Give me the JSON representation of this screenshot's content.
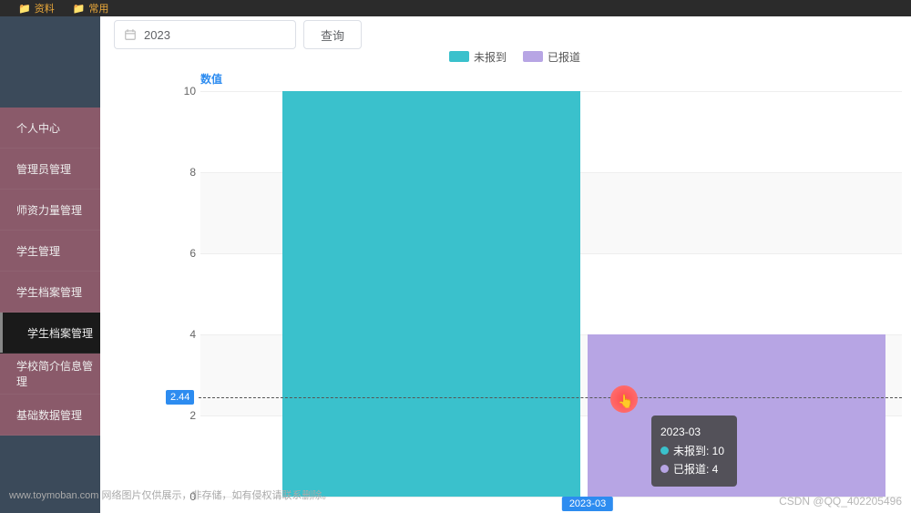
{
  "topbar": {
    "item1": "资料",
    "item2": "常用"
  },
  "toolbar": {
    "year": "2023",
    "query": "查询"
  },
  "sidebar": {
    "items": [
      {
        "label": "个人中心"
      },
      {
        "label": "管理员管理"
      },
      {
        "label": "师资力量管理"
      },
      {
        "label": "学生管理"
      },
      {
        "label": "学生档案管理"
      },
      {
        "label": "学生档案管理",
        "active": true
      },
      {
        "label": "学校简介信息管理"
      },
      {
        "label": "基础数据管理"
      }
    ]
  },
  "chart_data": {
    "type": "bar",
    "axis_title": "数值",
    "categories": [
      "2023-03"
    ],
    "series": [
      {
        "name": "未报到",
        "color": "#3ac1cc",
        "values": [
          10
        ]
      },
      {
        "name": "已报道",
        "color": "#b7a5e4",
        "values": [
          4
        ]
      }
    ],
    "ylim": [
      0,
      10
    ],
    "yticks": [
      0,
      2,
      4,
      6,
      8,
      10
    ],
    "marker_value": 2.44,
    "tooltip": {
      "title": "2023-03",
      "rows": [
        {
          "color": "#3ac1cc",
          "label": "未报到",
          "value": 10
        },
        {
          "color": "#b7a5e4",
          "label": "已报道",
          "value": 4
        }
      ]
    }
  },
  "footer": {
    "watermark": "www.toymoban.com 网络图片仅供展示，非存储，如有侵权请联系删除。",
    "copyright": "CSDN @QQ_402205496"
  }
}
